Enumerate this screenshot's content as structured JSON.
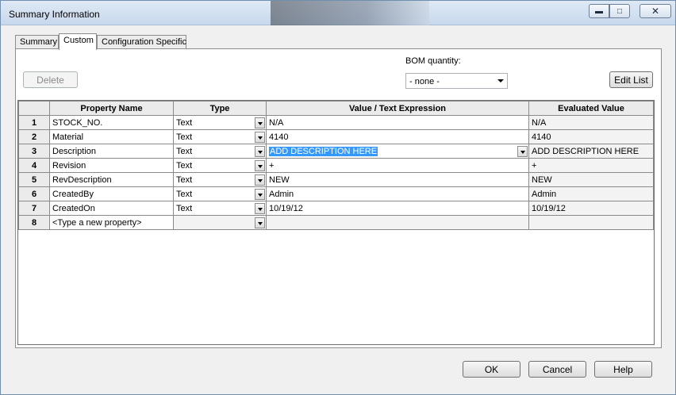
{
  "window": {
    "title": "Summary Information"
  },
  "tabs": [
    {
      "label": "Summary"
    },
    {
      "label": "Custom"
    },
    {
      "label": "Configuration Specific"
    }
  ],
  "toolbar": {
    "delete_label": "Delete",
    "bom_label": "BOM quantity:",
    "bom_value": "- none -",
    "edit_list_label": "Edit List"
  },
  "grid": {
    "headers": [
      "Property Name",
      "Type",
      "Value / Text Expression",
      "Evaluated Value"
    ],
    "rows": [
      {
        "num": "1",
        "name": "STOCK_NO.",
        "type": "Text",
        "value": "N/A",
        "evaluated": "N/A"
      },
      {
        "num": "2",
        "name": "Material",
        "type": "Text",
        "value": "4140",
        "evaluated": "4140"
      },
      {
        "num": "3",
        "name": "Description",
        "type": "Text",
        "value": "ADD DESCRIPTION HERE",
        "evaluated": "ADD DESCRIPTION HERE"
      },
      {
        "num": "4",
        "name": "Revision",
        "type": "Text",
        "value": "+",
        "evaluated": "+"
      },
      {
        "num": "5",
        "name": "RevDescription",
        "type": "Text",
        "value": "NEW",
        "evaluated": "NEW"
      },
      {
        "num": "6",
        "name": "CreatedBy",
        "type": "Text",
        "value": "Admin",
        "evaluated": "Admin"
      },
      {
        "num": "7",
        "name": "CreatedOn",
        "type": "Text",
        "value": "10/19/12",
        "evaluated": "10/19/12"
      },
      {
        "num": "8",
        "name": "<Type a new property>",
        "type": "",
        "value": "",
        "evaluated": ""
      }
    ]
  },
  "footer": {
    "ok_label": "OK",
    "cancel_label": "Cancel",
    "help_label": "Help"
  },
  "colors": {
    "selection": "#3399ff",
    "titlebar": "#c7d8ec"
  }
}
